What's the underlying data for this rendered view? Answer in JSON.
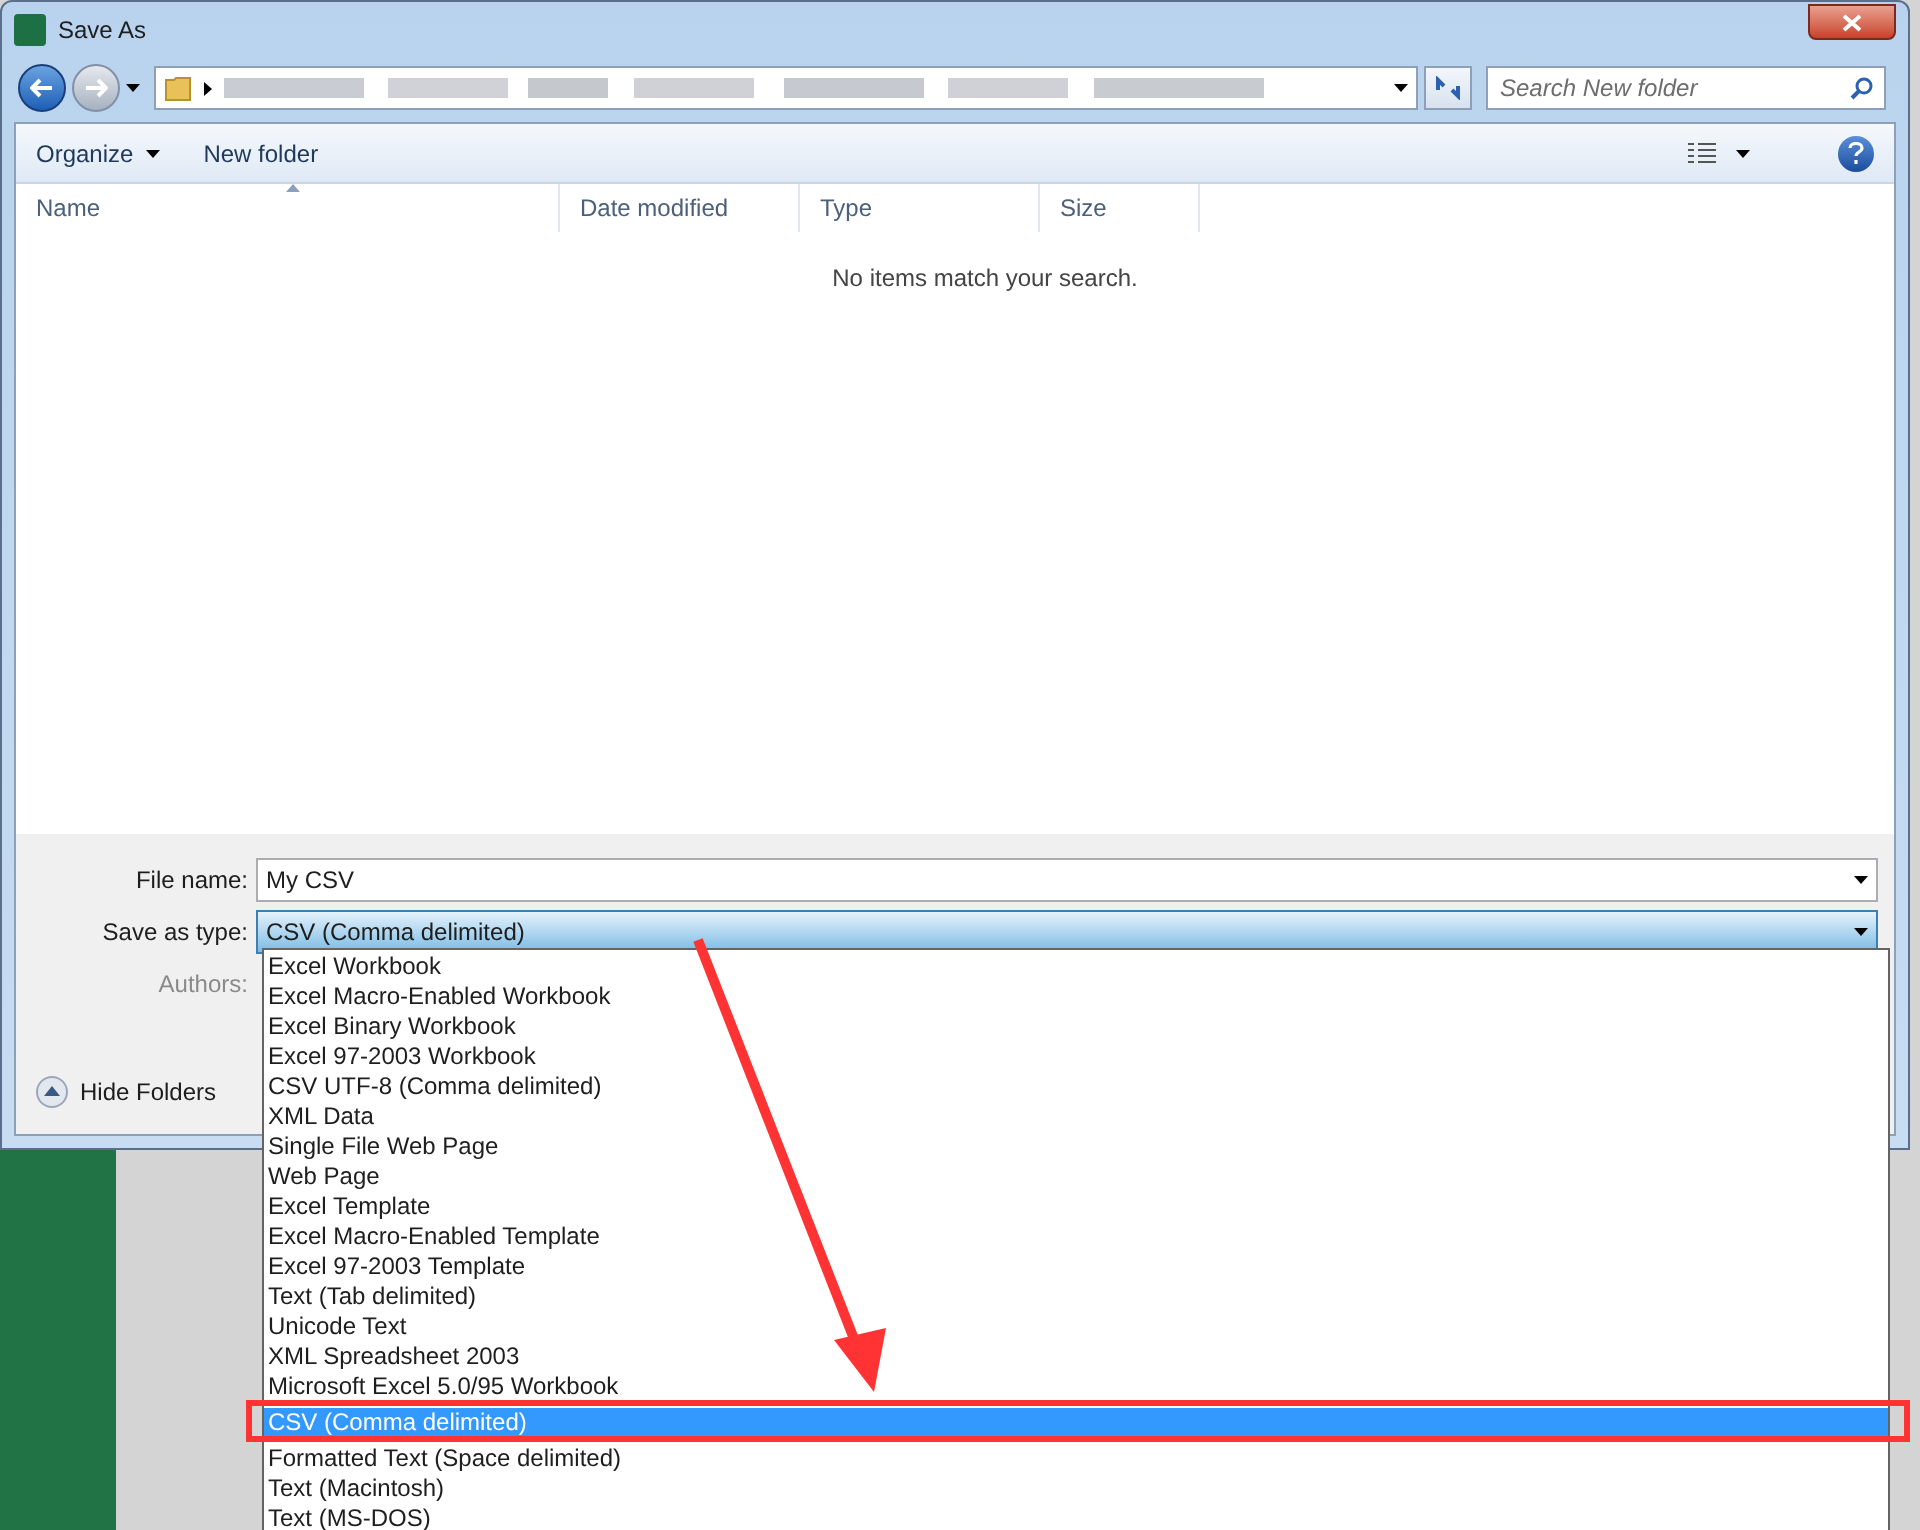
{
  "window": {
    "title": "Save As"
  },
  "search": {
    "placeholder": "Search New folder"
  },
  "toolbar": [
    {
      "label": "Organize",
      "has_menu": true
    },
    {
      "label": "New folder",
      "has_menu": false
    }
  ],
  "columns": [
    {
      "label": "Name",
      "sorted": true
    },
    {
      "label": "Date modified",
      "sorted": false
    },
    {
      "label": "Type",
      "sorted": false
    },
    {
      "label": "Size",
      "sorted": false
    }
  ],
  "empty_message": "No items match your search.",
  "form": {
    "file_name": {
      "label": "File name:",
      "value": "My CSV"
    },
    "save_as_type": {
      "label": "Save as type:",
      "value": "CSV (Comma delimited)",
      "expanded": true
    },
    "authors": {
      "label": "Authors:",
      "disabled": true
    }
  },
  "hide_folders": "Hide Folders",
  "type_list": [
    {
      "label": "Excel Workbook",
      "selected": false
    },
    {
      "label": "Excel Macro-Enabled Workbook",
      "selected": false
    },
    {
      "label": "Excel Binary Workbook",
      "selected": false
    },
    {
      "label": "Excel 97-2003 Workbook",
      "selected": false
    },
    {
      "label": "CSV UTF-8 (Comma delimited)",
      "selected": false
    },
    {
      "label": "XML Data",
      "selected": false
    },
    {
      "label": "Single File Web Page",
      "selected": false
    },
    {
      "label": "Web Page",
      "selected": false
    },
    {
      "label": "Excel Template",
      "selected": false
    },
    {
      "label": "Excel Macro-Enabled Template",
      "selected": false
    },
    {
      "label": "Excel 97-2003 Template",
      "selected": false
    },
    {
      "label": "Text (Tab delimited)",
      "selected": false
    },
    {
      "label": "Unicode Text",
      "selected": false
    },
    {
      "label": "XML Spreadsheet 2003",
      "selected": false
    },
    {
      "label": "Microsoft Excel 5.0/95 Workbook",
      "selected": false
    },
    {
      "label": "CSV (Comma delimited)",
      "selected": true
    },
    {
      "label": "Formatted Text (Space delimited)",
      "selected": false
    },
    {
      "label": "Text (Macintosh)",
      "selected": false
    },
    {
      "label": "Text (MS-DOS)",
      "selected": false
    }
  ]
}
